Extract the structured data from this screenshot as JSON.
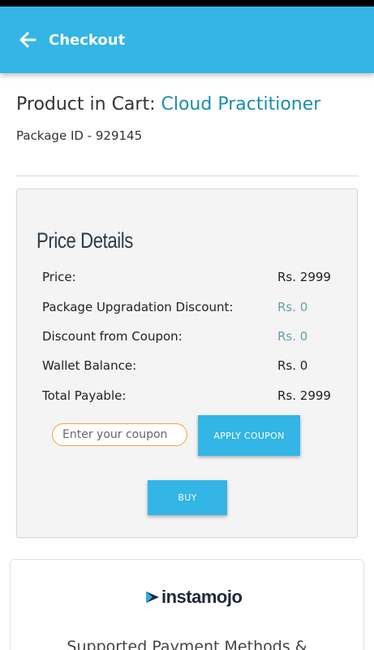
{
  "app_bar": {
    "title": "Checkout",
    "back_icon": "arrow-left-icon",
    "color": "#33b5e5"
  },
  "product": {
    "prefix": "Product in Cart: ",
    "name": "Cloud Practitioner",
    "package_id": "Package ID - 929145"
  },
  "price_details": {
    "title": "Price Details",
    "rows": [
      {
        "label": "Price:",
        "value": "Rs. 2999"
      },
      {
        "label": "Package Upgradation Discount:",
        "value": "Rs. 0"
      },
      {
        "label": "Discount from Coupon:",
        "value": "Rs. 0"
      },
      {
        "label": "Wallet Balance:",
        "value": "Rs. 0"
      },
      {
        "label": "Total Payable:",
        "value": "Rs. 2999"
      }
    ],
    "coupon": {
      "placeholder": "Enter your coupon",
      "value": ""
    },
    "apply_label": "APPLY COUPON",
    "buy_label": "BUY"
  },
  "payment": {
    "logo_text": "instamojo",
    "methods_text": "Supported Payment Methods &"
  }
}
